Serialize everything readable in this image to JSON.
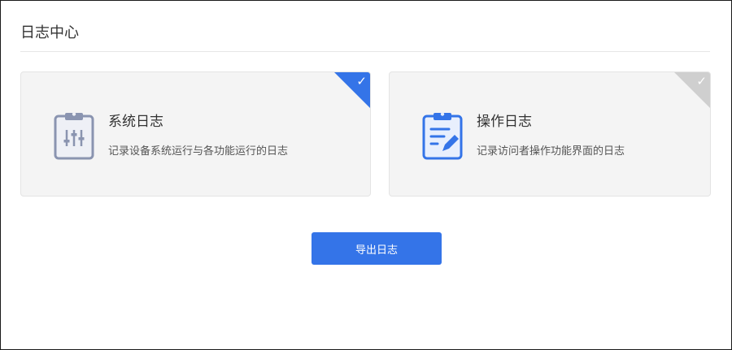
{
  "page": {
    "title": "日志中心"
  },
  "cards": [
    {
      "id": "system-log",
      "title": "系统日志",
      "description": "记录设备系统运行与各功能运行的日志",
      "icon": "clipboard-sliders-icon",
      "selected": true,
      "check_glyph": "✓",
      "corner_color": "#3474e8"
    },
    {
      "id": "operation-log",
      "title": "操作日志",
      "description": "记录访问者操作功能界面的日志",
      "icon": "clipboard-edit-icon",
      "selected": false,
      "check_glyph": "✓",
      "corner_color": "#cfcfcf"
    }
  ],
  "actions": {
    "export_label": "导出日志"
  },
  "colors": {
    "accent": "#3474e8",
    "card_bg": "#f4f4f4",
    "divider": "#e6e6e6"
  }
}
